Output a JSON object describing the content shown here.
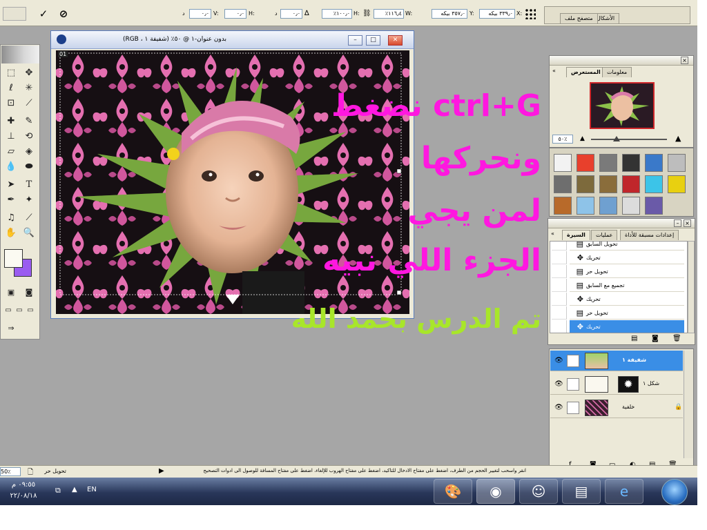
{
  "options_bar": {
    "panel_tabs": [
      {
        "label": "الأشكال"
      },
      {
        "label": "متصفح ملف"
      }
    ],
    "fields": {
      "x_label": "X:",
      "x_value": "٣٣٩٫٠ بيكه",
      "y_label": "Y:",
      "y_value": "٣٥٧٫٠ بيكه",
      "w_label": "W:",
      "w_value": "١١٦٫٤٪",
      "h_label": "H:",
      "h_value": "١٠٠٫٠٪",
      "angle_value": "٠٫٠",
      "angle_unit": "د",
      "hskew_label": "H:",
      "hskew_value": "٠٫٠",
      "vskew_label": "V:",
      "vskew_value": "٠٫٠",
      "skew_unit": "د"
    },
    "commit_icon": "checkmark-icon",
    "cancel_icon": "cancel-icon"
  },
  "document": {
    "title": "بدون عنوان-١ @ ٥٠٪ (شفيفة ١ ، RGB)",
    "page_tag": "01"
  },
  "overlay_text": {
    "line1": "نضغط ctrl+G",
    "line2": "ونحركها",
    "line3": "لمن يجي",
    "line4": "الجزء اللي نبيه",
    "line5": "تم الدرس بحمد الله"
  },
  "navigator": {
    "tabs": [
      {
        "label": "المستعرض"
      },
      {
        "label": "معلومات"
      }
    ],
    "zoom": "٥٠٪"
  },
  "styles_palette": {
    "swatches": [
      "#f2f2f2",
      "#e8402c",
      "#7a7a7a",
      "#333333",
      "#3a79c9",
      "#bdbdbd",
      "#6e6e6e",
      "#7d6a3c",
      "#8a6d3b",
      "#c0262b",
      "#3cc4e8",
      "#e8d010",
      "#b86a2a",
      "#8ec3e8",
      "#6fa0d0",
      "#dcdcdc",
      "#6a5aa8"
    ]
  },
  "history": {
    "tabs": [
      {
        "label": "السيرة"
      },
      {
        "label": "عمليات"
      },
      {
        "label": "إعدادات مسبقة للأداة"
      }
    ],
    "items": [
      {
        "label": "تحويل السابق",
        "icon": "doc-icon"
      },
      {
        "label": "تحريك",
        "icon": "move-icon"
      },
      {
        "label": "تحويل حر",
        "icon": "doc-icon"
      },
      {
        "label": "تجميع مع السابق",
        "icon": "doc-icon"
      },
      {
        "label": "تحريك",
        "icon": "move-icon"
      },
      {
        "label": "تحويل حر",
        "icon": "doc-icon"
      },
      {
        "label": "تحريك",
        "icon": "move-icon",
        "selected": true
      }
    ]
  },
  "layers": {
    "items": [
      {
        "name": "شفيفة ١",
        "selected": true
      },
      {
        "name": "شكل ١",
        "selected": false
      },
      {
        "name": "خلفية",
        "selected": false
      }
    ]
  },
  "status_bar": {
    "zoom": "50٪",
    "tool": "تحويل حر",
    "hint": "انقر واسحب لتغيير الحجم من الطرف، اضغط على مفتاح الادخال للتأكيد، اضغط على مفتاح الهروب للإلغاء، اضغط على مفتاح المسافة للوصول الى ادوات التصحيح"
  },
  "taskbar": {
    "clock_time": "٠٩:٥٥ م",
    "clock_date": "٢٢/٠٨/١٨",
    "language": "EN"
  },
  "colors": {
    "workspace": "#a6a6a6",
    "overlay_magenta": "#ff17e0",
    "overlay_green": "#a8e62a",
    "selection_blue": "#3a8ee6",
    "background_color_chip": "#9a5cf0"
  }
}
